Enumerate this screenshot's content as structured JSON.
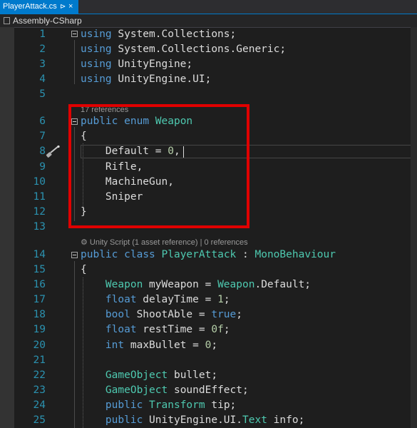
{
  "tab": {
    "title": "PlayerAttack.cs",
    "pin": "⊳",
    "close": "×"
  },
  "navbar": {
    "project": "Assembly-CSharp"
  },
  "codelens": {
    "enum_refs": "17 references",
    "class_refs": "⚙ Unity Script (1 asset reference) | 0 references"
  },
  "lines": [
    {
      "n": "1",
      "tokens": [
        [
          "kw",
          "using"
        ],
        [
          "t",
          " System.Collections;"
        ]
      ]
    },
    {
      "n": "2",
      "tokens": [
        [
          "kw",
          "using"
        ],
        [
          "t",
          " System.Collections.Generic;"
        ]
      ]
    },
    {
      "n": "3",
      "tokens": [
        [
          "kw",
          "using"
        ],
        [
          "t",
          " UnityEngine;"
        ]
      ]
    },
    {
      "n": "4",
      "tokens": [
        [
          "kw",
          "using"
        ],
        [
          "t",
          " UnityEngine.UI;"
        ]
      ]
    },
    {
      "n": "5",
      "tokens": []
    },
    {
      "n": "6",
      "tokens": [
        [
          "kw",
          "public"
        ],
        [
          "t",
          " "
        ],
        [
          "kw",
          "enum"
        ],
        [
          "t",
          " "
        ],
        [
          "ty",
          "Weapon"
        ]
      ]
    },
    {
      "n": "7",
      "tokens": [
        [
          "t",
          "{"
        ]
      ]
    },
    {
      "n": "8",
      "tokens": [
        [
          "t",
          "    Default = "
        ],
        [
          "nm",
          "0"
        ],
        [
          "t",
          ","
        ]
      ]
    },
    {
      "n": "9",
      "tokens": [
        [
          "t",
          "    Rifle,"
        ]
      ]
    },
    {
      "n": "10",
      "tokens": [
        [
          "t",
          "    MachineGun,"
        ]
      ]
    },
    {
      "n": "11",
      "tokens": [
        [
          "t",
          "    Sniper"
        ]
      ]
    },
    {
      "n": "12",
      "tokens": [
        [
          "t",
          "}"
        ]
      ]
    },
    {
      "n": "13",
      "tokens": []
    },
    {
      "n": "14",
      "tokens": [
        [
          "kw",
          "public"
        ],
        [
          "t",
          " "
        ],
        [
          "kw",
          "class"
        ],
        [
          "t",
          " "
        ],
        [
          "ty",
          "PlayerAttack"
        ],
        [
          "t",
          " : "
        ],
        [
          "ty",
          "MonoBehaviour"
        ]
      ]
    },
    {
      "n": "15",
      "tokens": [
        [
          "t",
          "{"
        ]
      ]
    },
    {
      "n": "16",
      "tokens": [
        [
          "t",
          "    "
        ],
        [
          "ty",
          "Weapon"
        ],
        [
          "t",
          " myWeapon = "
        ],
        [
          "ty",
          "Weapon"
        ],
        [
          "t",
          ".Default;"
        ]
      ]
    },
    {
      "n": "17",
      "tokens": [
        [
          "t",
          "    "
        ],
        [
          "kw",
          "float"
        ],
        [
          "t",
          " delayTime = "
        ],
        [
          "nm",
          "1"
        ],
        [
          "t",
          ";"
        ]
      ]
    },
    {
      "n": "18",
      "tokens": [
        [
          "t",
          "    "
        ],
        [
          "kw",
          "bool"
        ],
        [
          "t",
          " ShootAble = "
        ],
        [
          "kw",
          "true"
        ],
        [
          "t",
          ";"
        ]
      ]
    },
    {
      "n": "19",
      "tokens": [
        [
          "t",
          "    "
        ],
        [
          "kw",
          "float"
        ],
        [
          "t",
          " restTime = "
        ],
        [
          "nm",
          "0f"
        ],
        [
          "t",
          ";"
        ]
      ]
    },
    {
      "n": "20",
      "tokens": [
        [
          "t",
          "    "
        ],
        [
          "kw",
          "int"
        ],
        [
          "t",
          " maxBullet = "
        ],
        [
          "nm",
          "0"
        ],
        [
          "t",
          ";"
        ]
      ]
    },
    {
      "n": "21",
      "tokens": []
    },
    {
      "n": "22",
      "tokens": [
        [
          "t",
          "    "
        ],
        [
          "ty",
          "GameObject"
        ],
        [
          "t",
          " bullet;"
        ]
      ]
    },
    {
      "n": "23",
      "tokens": [
        [
          "t",
          "    "
        ],
        [
          "ty",
          "GameObject"
        ],
        [
          "t",
          " soundEffect;"
        ]
      ]
    },
    {
      "n": "24",
      "tokens": [
        [
          "t",
          "    "
        ],
        [
          "kw",
          "public"
        ],
        [
          "t",
          " "
        ],
        [
          "ty",
          "Transform"
        ],
        [
          "t",
          " tip;"
        ]
      ]
    },
    {
      "n": "25",
      "tokens": [
        [
          "t",
          "    "
        ],
        [
          "kw",
          "public"
        ],
        [
          "t",
          " UnityEngine.UI."
        ],
        [
          "ty",
          "Text"
        ],
        [
          "t",
          " info;"
        ]
      ]
    }
  ]
}
